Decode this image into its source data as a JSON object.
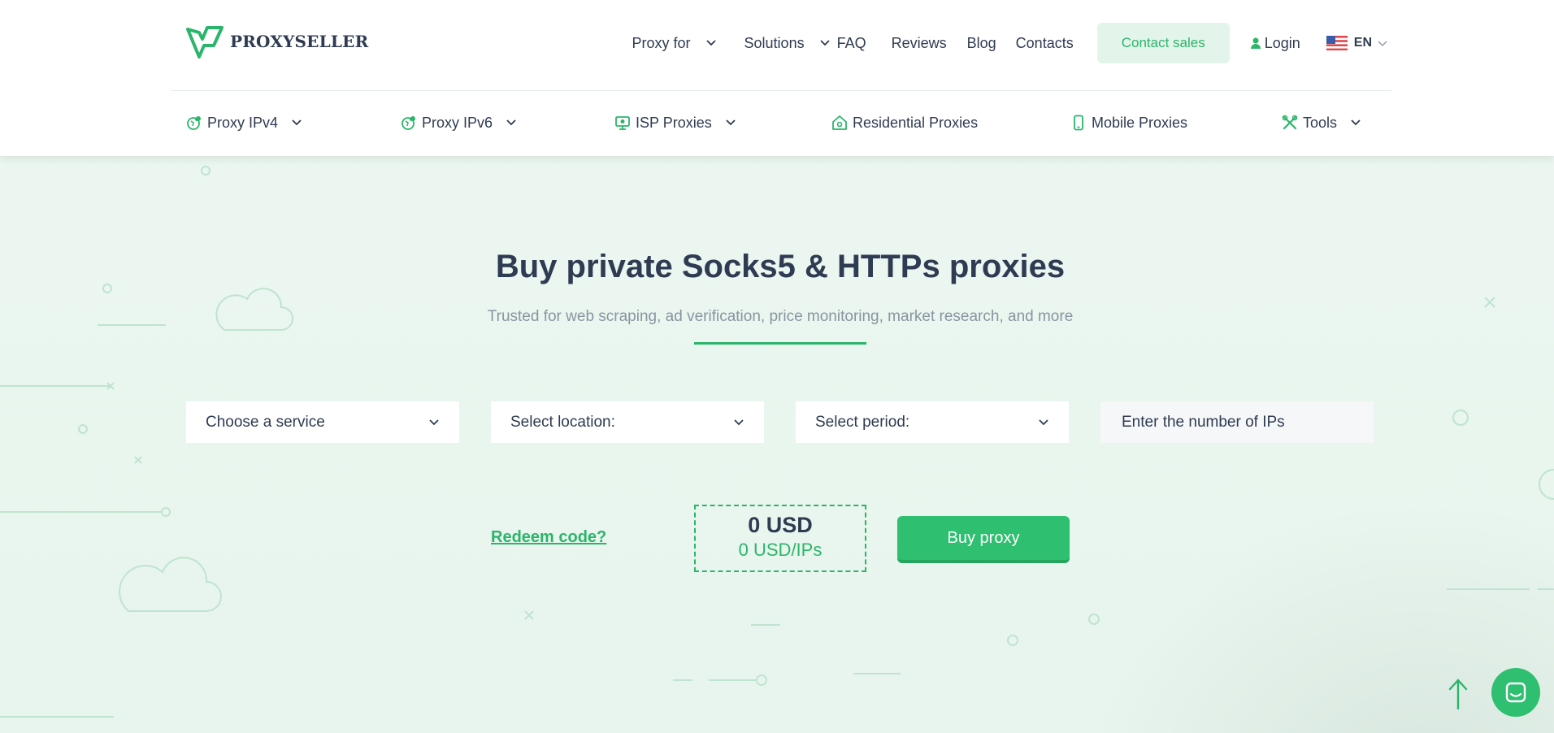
{
  "brand": {
    "name": "PROXYSELLER",
    "accent": "#2bb56b",
    "button": "#2fbf70",
    "text": "#2f3b52"
  },
  "topnav": {
    "proxy_for": "Proxy for",
    "solutions": "Solutions",
    "faq": "FAQ",
    "reviews": "Reviews",
    "blog": "Blog",
    "contacts": "Contacts",
    "contact_sales": "Contact sales",
    "login": "Login",
    "language": "EN",
    "language_flag": "us-flag-icon"
  },
  "subnav": {
    "ipv4": "Proxy IPv4",
    "ipv6": "Proxy IPv6",
    "isp": "ISP Proxies",
    "residential": "Residential Proxies",
    "mobile": "Mobile Proxies",
    "tools": "Tools"
  },
  "hero": {
    "title": "Buy private Socks5 & HTTPs proxies",
    "subtitle": "Trusted for web scraping, ad verification, price monitoring, market research, and more"
  },
  "form": {
    "service": "Choose a service",
    "location": "Select location:",
    "period": "Select period:",
    "ips_placeholder": "Enter the number of IPs"
  },
  "checkout": {
    "redeem": "Redeem code?",
    "total": "0 USD",
    "per_ip": "0 USD/IPs",
    "buy": "Buy proxy"
  },
  "icons": [
    "chevron-down-icon",
    "user-icon",
    "globe-icon",
    "monitor-icon",
    "home-icon",
    "phone-icon",
    "tools-icon",
    "arrow-up-icon",
    "chat-icon"
  ]
}
